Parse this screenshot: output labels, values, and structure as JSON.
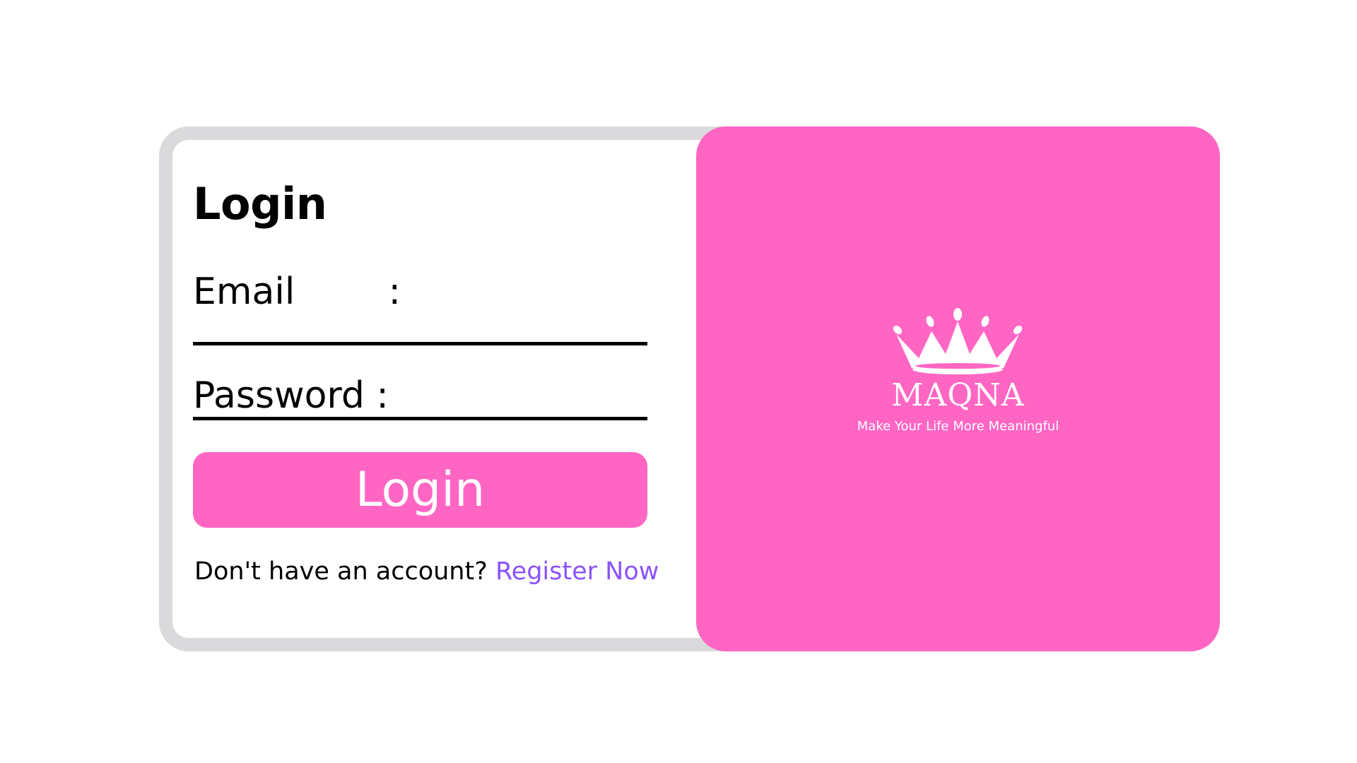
{
  "login_form": {
    "title": "Login",
    "email_label": "Email        :",
    "password_label": "Password :",
    "email_value": "",
    "password_value": "",
    "submit_label": "Login",
    "register_prompt": "Don't have an account?",
    "register_link": "Register Now"
  },
  "brand": {
    "logo_icon": "crown-icon",
    "name": "MAQNA",
    "tagline": "Make Your Life More Meaningful"
  },
  "colors": {
    "accent": "#ff66c4",
    "link": "#8c52ff",
    "card_border": "#dadadc",
    "text": "#000000",
    "background": "#ffffff"
  }
}
